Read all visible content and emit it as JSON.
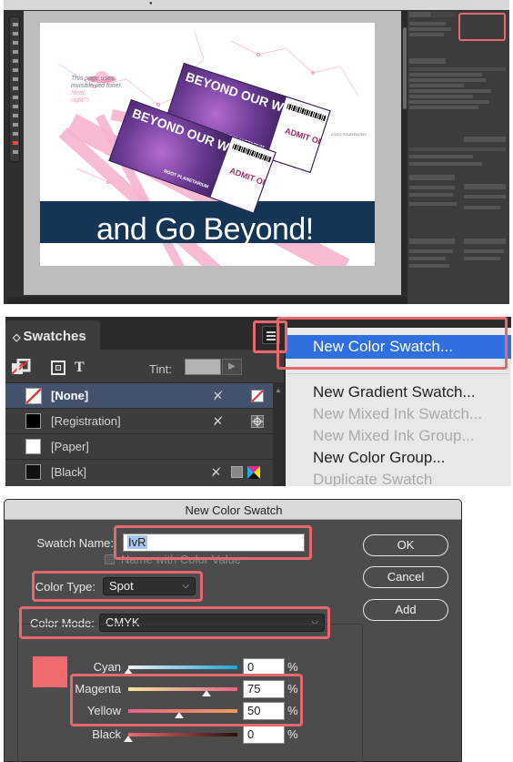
{
  "colors": {
    "callout": "#e8686e",
    "pink": "#f6b4cf",
    "navy": "#143553",
    "ticket": "#6a3a93",
    "menu_highlight": "#2f6fe0",
    "swatch_preview": "#f06a6e"
  },
  "workspace": {
    "note_line1": "This page uses",
    "note_line2": "invisible red toner.",
    "note_line3": "Neat,",
    "note_line4": "right?!",
    "ticket_title": "BEYOND OUR WORLD",
    "ticket_sub": "ROOT PLANETARIUM",
    "admit": "ADMIT ONE",
    "headline": "and Go Beyond!",
    "small_caption": "LOGO YOUR ENTRY"
  },
  "swatches_panel": {
    "title": "Swatches",
    "tint_label": "Tint:",
    "items": [
      {
        "label": "[None]"
      },
      {
        "label": "[Registration]"
      },
      {
        "label": "[Paper]"
      },
      {
        "label": "[Black]"
      }
    ],
    "menu": {
      "items": [
        {
          "label": "New Color Swatch...",
          "state": "highlighted"
        },
        {
          "label": "New Gradient Swatch...",
          "state": "enabled"
        },
        {
          "label": "New Mixed Ink Swatch...",
          "state": "disabled"
        },
        {
          "label": "New Mixed Ink Group...",
          "state": "disabled"
        },
        {
          "label": "New Color Group...",
          "state": "enabled"
        },
        {
          "label": "Duplicate Swatch",
          "state": "disabled"
        }
      ]
    }
  },
  "dialog": {
    "title": "New Color Swatch",
    "swatch_name_label": "Swatch Name:",
    "swatch_name_value": "IvR",
    "name_with_value_label": "Name with Color Value",
    "color_type_label": "Color Type:",
    "color_type_value": "Spot",
    "color_mode_label": "Color Mode:",
    "color_mode_value": "CMYK",
    "buttons": {
      "ok": "OK",
      "cancel": "Cancel",
      "add": "Add"
    },
    "sliders": [
      {
        "label": "Cyan",
        "value": "0",
        "unit": "%"
      },
      {
        "label": "Magenta",
        "value": "75",
        "unit": "%"
      },
      {
        "label": "Yellow",
        "value": "50",
        "unit": "%"
      },
      {
        "label": "Black",
        "value": "0",
        "unit": "%"
      }
    ]
  }
}
